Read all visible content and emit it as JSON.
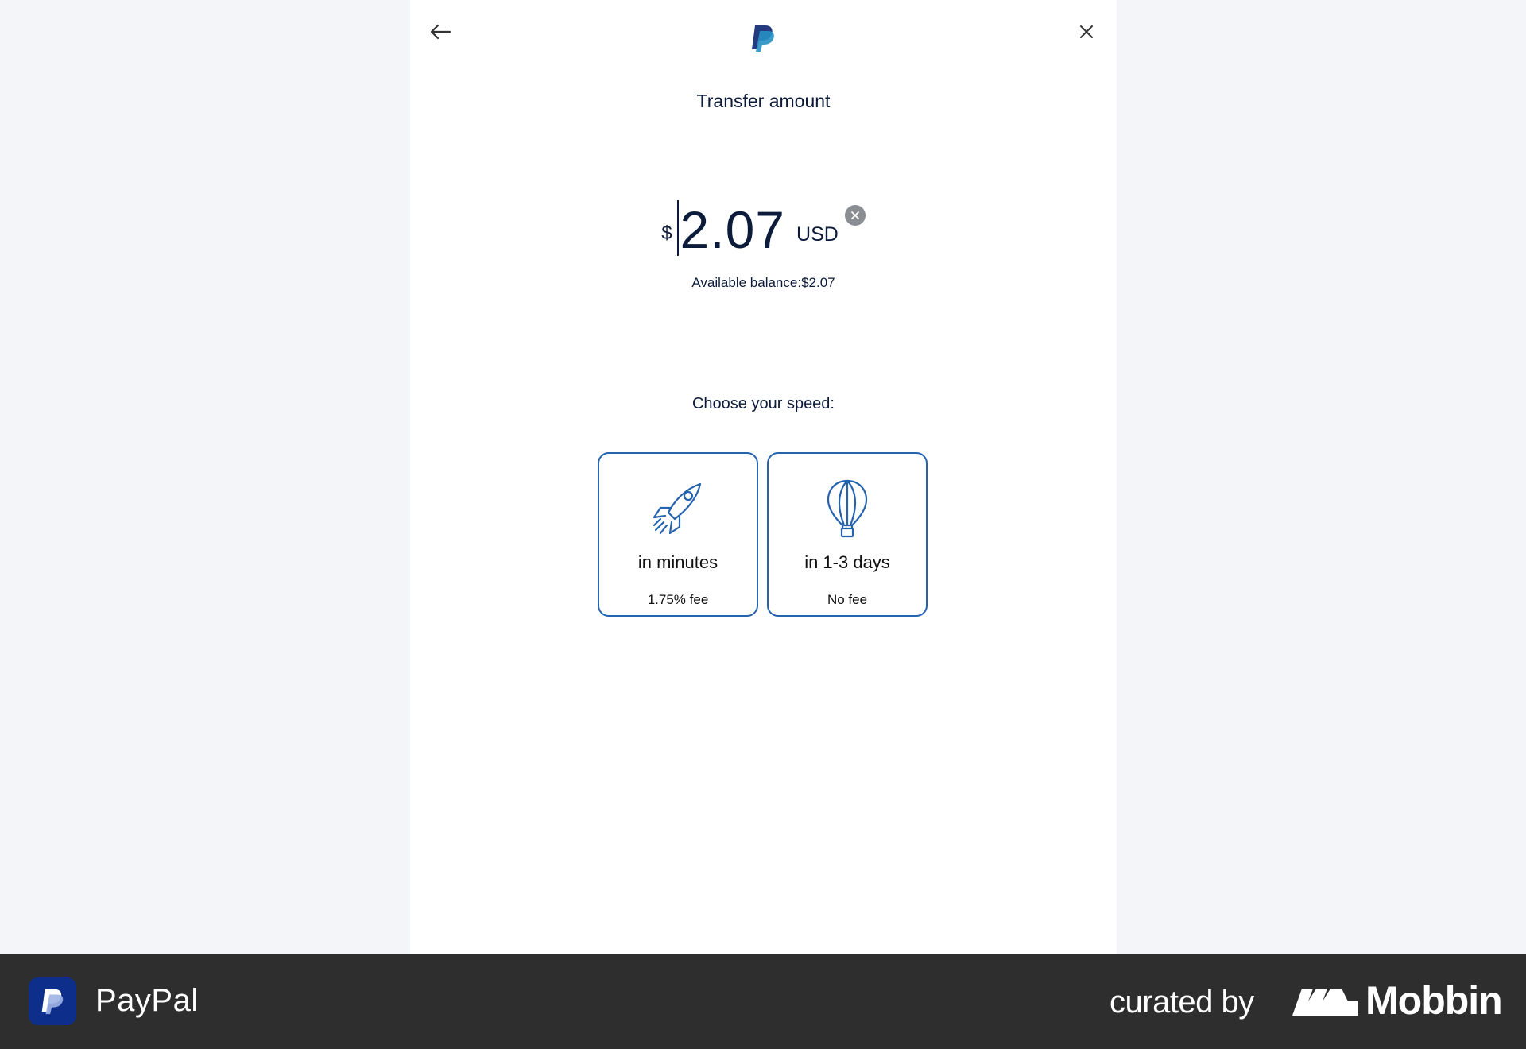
{
  "header": {
    "title": "Transfer amount"
  },
  "amount": {
    "currency_symbol": "$",
    "value": "2.07",
    "currency_code": "USD",
    "balance_text": "Available balance:$2.07"
  },
  "speed": {
    "label": "Choose your speed:",
    "options": [
      {
        "title": "in minutes",
        "fee": "1.75% fee",
        "icon": "rocket-icon"
      },
      {
        "title": "in 1-3 days",
        "fee": "No fee",
        "icon": "hot-air-balloon-icon"
      }
    ]
  },
  "footer": {
    "app_name": "PayPal",
    "curated_by": "curated by",
    "brand": "Mobbin"
  },
  "colors": {
    "accent": "#2563ae",
    "text": "#0c1b3a",
    "background": "#f4f5f8",
    "footer": "#2e2e2e"
  }
}
